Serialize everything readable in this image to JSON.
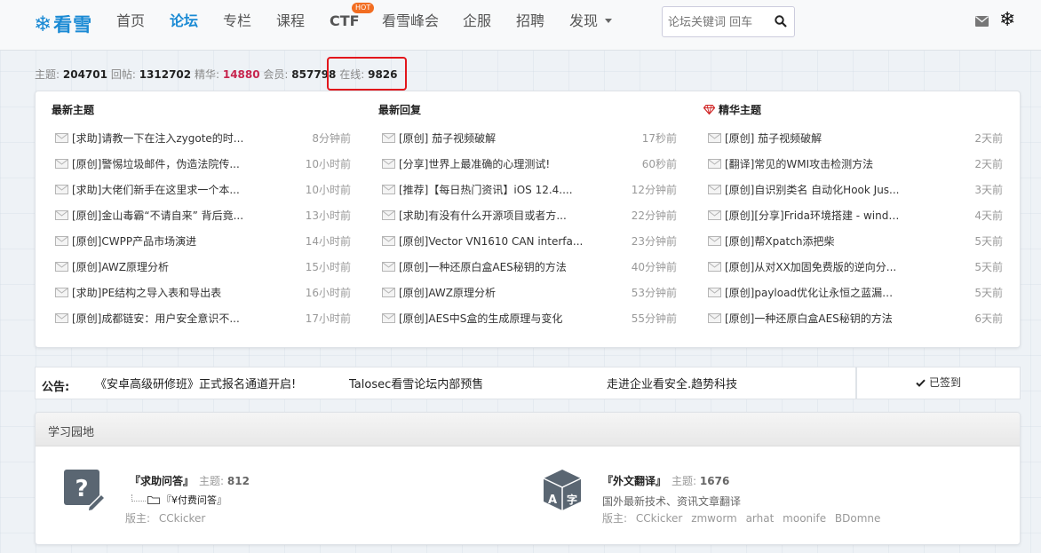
{
  "nav": {
    "logo": "看雪",
    "items": [
      "首页",
      "论坛",
      "专栏",
      "课程",
      "CTF",
      "看雪峰会",
      "企服",
      "招聘",
      "发现"
    ],
    "hot_badge": "HOT",
    "search_placeholder": "论坛关键词 回车"
  },
  "stats": {
    "topics_label": "主题:",
    "topics": "204701",
    "posts_label": "回帖:",
    "posts": "1312702",
    "elite_label": "精华:",
    "elite": "14880",
    "members_label": "会员:",
    "members": "857798",
    "online_label": "在线:",
    "online": "9826"
  },
  "latest_topics": {
    "title": "最新主题",
    "rows": [
      {
        "title": "[求助]请教一下在注入zygote的时...",
        "time": "8分钟前"
      },
      {
        "title": "[原创]警惕垃圾邮件，伪造法院传...",
        "time": "10小时前"
      },
      {
        "title": "[求助]大佬们新手在这里求一个本...",
        "time": "10小时前"
      },
      {
        "title": "[原创]金山毒霸“不请自来” 背后竟...",
        "time": "13小时前"
      },
      {
        "title": "[原创]CWPP产品市场演进",
        "time": "14小时前"
      },
      {
        "title": "[原创]AWZ原理分析",
        "time": "15小时前"
      },
      {
        "title": "[求助]PE结构之导入表和导出表",
        "time": "16小时前"
      },
      {
        "title": "[原创]成都链安：用户安全意识不...",
        "time": "17小时前"
      }
    ]
  },
  "latest_replies": {
    "title": "最新回复",
    "rows": [
      {
        "title": "[原创] 茄子视频破解",
        "time": "17秒前"
      },
      {
        "title": "[分享]世界上最准确的心理测试!",
        "time": "60秒前"
      },
      {
        "title": "[推荐]【每日热门资讯】iOS 12.4....",
        "time": "12分钟前"
      },
      {
        "title": "[求助]有没有什么开源项目或者方...",
        "time": "22分钟前"
      },
      {
        "title": "[原创]Vector VN1610 CAN interfa...",
        "time": "23分钟前"
      },
      {
        "title": "[原创]一种还原白盒AES秘钥的方法",
        "time": "40分钟前"
      },
      {
        "title": "[原创]AWZ原理分析",
        "time": "53分钟前"
      },
      {
        "title": "[原创]AES中S盒的生成原理与变化",
        "time": "55分钟前"
      }
    ]
  },
  "elite_topics": {
    "title": "精华主题",
    "rows": [
      {
        "title": "[原创] 茄子视频破解",
        "time": "2天前"
      },
      {
        "title": "[翻译]常见的WMI攻击检测方法",
        "time": "2天前"
      },
      {
        "title": "[原创]自识别类名 自动化Hook Jus...",
        "time": "3天前"
      },
      {
        "title": "[原创][分享]Frida环境搭建 - windo...",
        "time": "4天前"
      },
      {
        "title": "[原创]帮Xpatch添把柴",
        "time": "5天前"
      },
      {
        "title": "[原创]从对XX加固免费版的逆向分...",
        "time": "5天前"
      },
      {
        "title": "[原创]payload优化让永恒之蓝漏洞...",
        "time": "5天前"
      },
      {
        "title": "[原创]一种还原白盒AES秘钥的方法",
        "time": "6天前"
      }
    ]
  },
  "announcement": {
    "label": "公告:",
    "items": [
      "《安卓高级研修班》正式报名通道开启!",
      "Talosec看雪论坛内部预售",
      "走进企业看安全.趋势科技"
    ],
    "signed": "已签到"
  },
  "study": {
    "title": "学习园地",
    "forums": [
      {
        "name": "『求助问答』",
        "topics_label": "主题:",
        "topics": "812",
        "sub": "『¥付费问答』",
        "desc": "",
        "mod_label": "版主:",
        "mods": [
          "CCkicker"
        ]
      },
      {
        "name": "『外文翻译』",
        "topics_label": "主题:",
        "topics": "1676",
        "sub": "",
        "desc": "国外最新技术、资讯文章翻译",
        "mod_label": "版主:",
        "mods": [
          "CCkicker",
          "zmworm",
          "arhat",
          "moonife",
          "BDomne"
        ]
      }
    ]
  },
  "colors": {
    "brand": "#1a8ad4",
    "elite_red": "#c7254e",
    "highlight_box": "#e2161c",
    "hot": "#f26d21"
  }
}
